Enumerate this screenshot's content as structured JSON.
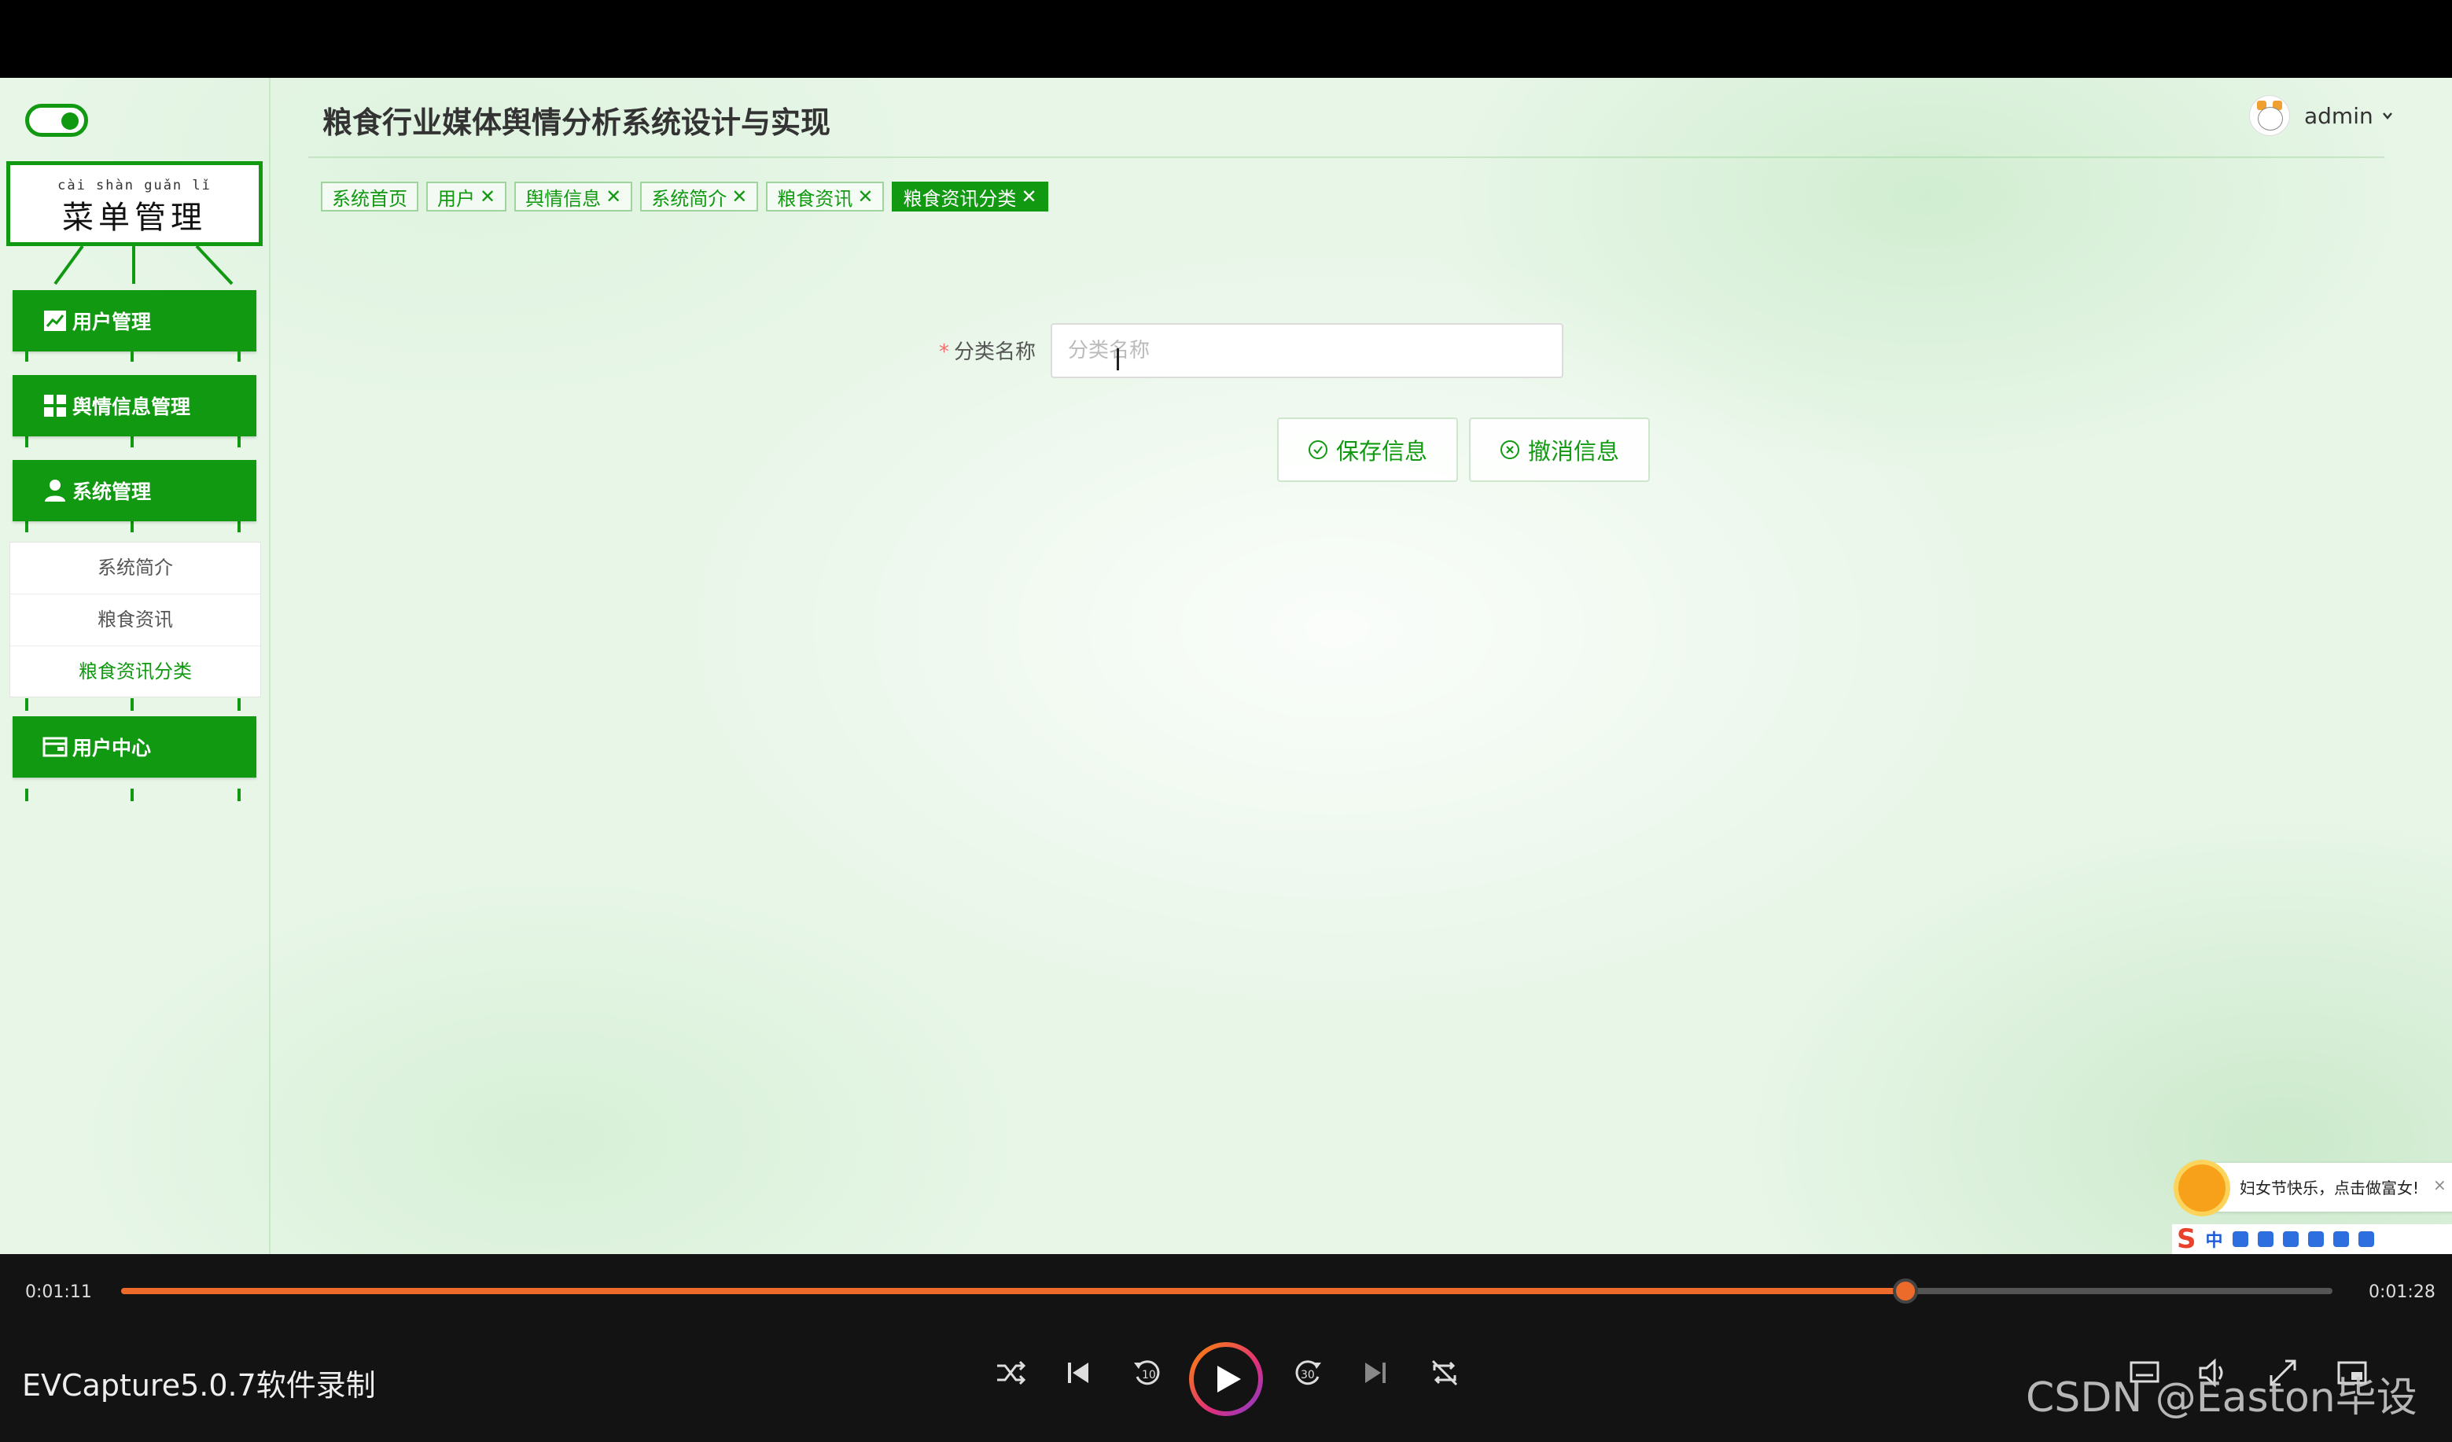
{
  "app": {
    "title": "粮食行业媒体舆情分析系统设计与实现"
  },
  "header": {
    "username": "admin"
  },
  "sidebar": {
    "sign_pinyin": "cài shàn guǎn lǐ",
    "sign_title": "菜单管理",
    "items": [
      {
        "label": "用户管理",
        "icon": "chart-line-icon"
      },
      {
        "label": "舆情信息管理",
        "icon": "grid-icon"
      },
      {
        "label": "系统管理",
        "icon": "user-icon"
      },
      {
        "label": "用户中心",
        "icon": "wallet-icon"
      }
    ],
    "submenu": [
      "系统简介",
      "粮食资讯",
      "粮食资讯分类"
    ],
    "active_sub": "粮食资讯分类"
  },
  "tags": [
    {
      "label": "系统首页",
      "closable": false
    },
    {
      "label": "用户",
      "closable": true
    },
    {
      "label": "舆情信息",
      "closable": true
    },
    {
      "label": "系统简介",
      "closable": true
    },
    {
      "label": "粮食资讯",
      "closable": true
    },
    {
      "label": "粮食资讯分类",
      "closable": true,
      "active": true
    }
  ],
  "tag_close_glyph": "✕",
  "form": {
    "required_mark": "*",
    "field_label": "分类名称",
    "field_placeholder": "分类名称",
    "field_value": "",
    "save_label": "保存信息",
    "cancel_label": "撤消信息"
  },
  "ime": {
    "notice": "妇女节快乐，点击做富女!",
    "close": "×",
    "logo": "S",
    "lang": "中"
  },
  "player": {
    "current_time": "0:01:11",
    "total_time": "0:01:28",
    "progress_fraction": 0.807,
    "watermark": "EVCapture5.0.7软件录制",
    "credit": "CSDN @Easton毕设"
  },
  "colors": {
    "primary": "#119911",
    "progress": "#ec6a2a",
    "required": "#f56c6c"
  }
}
